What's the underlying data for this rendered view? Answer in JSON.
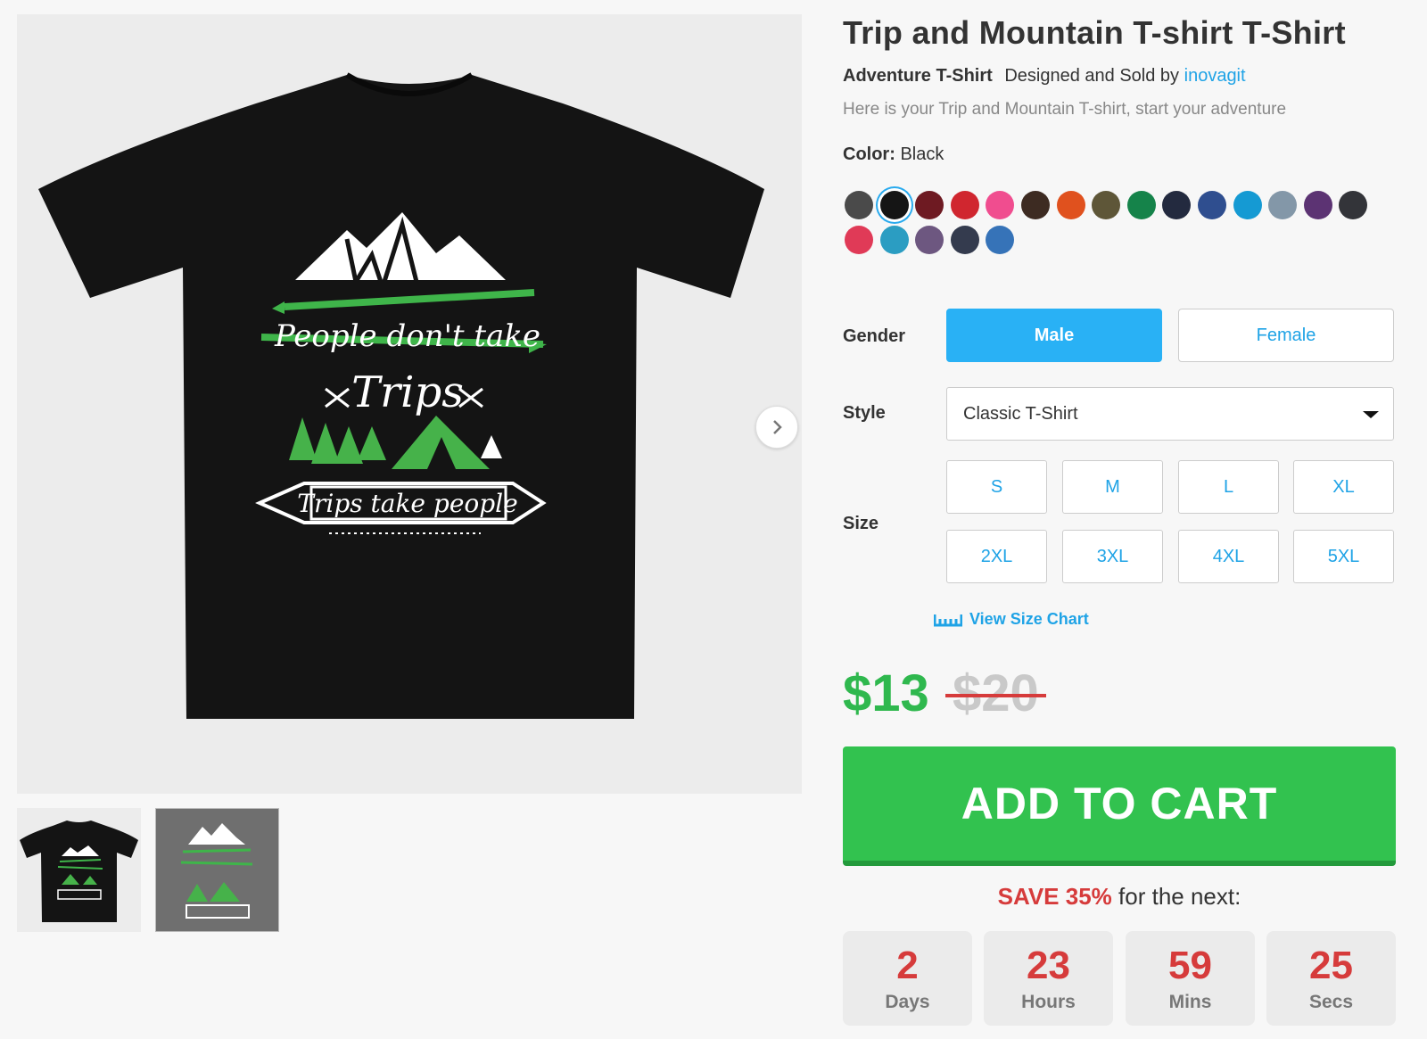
{
  "product": {
    "title": "Trip and Mountain T-shirt T-Shirt",
    "category": "Adventure T-Shirt",
    "designed_by_text": "Designed and Sold by",
    "designer": "inovagit",
    "description": "Here is your Trip and Mountain T-shirt, start your adventure"
  },
  "design_text": {
    "line1": "People don't take",
    "line2": "Trips",
    "line3": "Trips take people"
  },
  "color": {
    "label": "Color:",
    "selected": "Black",
    "swatches": [
      "#4a4a4a",
      "#151515",
      "#6e1a22",
      "#d0262f",
      "#f04d8f",
      "#3d2b22",
      "#e0511e",
      "#5e5638",
      "#15834a",
      "#232a3f",
      "#2f4e8f",
      "#159ad3",
      "#8397a8",
      "#5c3373",
      "#333439",
      "#e03a57",
      "#2b9dc2",
      "#6d5780",
      "#343b4e",
      "#3673b8"
    ]
  },
  "gender": {
    "label": "Gender",
    "male": "Male",
    "female": "Female"
  },
  "style": {
    "label": "Style",
    "value": "Classic T-Shirt"
  },
  "size": {
    "label": "Size",
    "options": [
      "S",
      "M",
      "L",
      "XL",
      "2XL",
      "3XL",
      "4XL",
      "5XL"
    ],
    "chart_link": "View Size Chart"
  },
  "price": {
    "current": "$13",
    "original": "$20"
  },
  "cart": {
    "button": "ADD TO CART"
  },
  "promo": {
    "save": "SAVE 35%",
    "rest": "for the next:"
  },
  "countdown": [
    {
      "value": "2",
      "unit": "Days"
    },
    {
      "value": "23",
      "unit": "Hours"
    },
    {
      "value": "59",
      "unit": "Mins"
    },
    {
      "value": "25",
      "unit": "Secs"
    }
  ],
  "icons": {
    "next": "chevron-right-icon",
    "ruler": "ruler-icon"
  },
  "accent_colors": {
    "blue": "#29b1f5",
    "green": "#32c24f",
    "red": "#d63b3b"
  }
}
